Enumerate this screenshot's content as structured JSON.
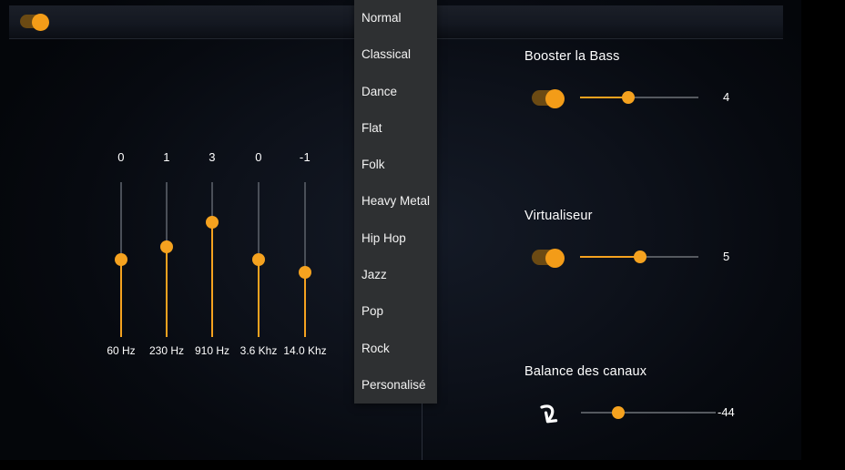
{
  "window": {
    "toolbar": {
      "power_toggle_label": "power-toggle",
      "power_toggle_state": "on"
    }
  },
  "equalizer": {
    "bands": [
      {
        "value": "0",
        "freq": "60 Hz",
        "level": 0,
        "knob_pct": 50
      },
      {
        "value": "1",
        "freq": "230 Hz",
        "level": 1,
        "knob_pct": 42
      },
      {
        "value": "3",
        "freq": "910 Hz",
        "level": 3,
        "knob_pct": 26
      },
      {
        "value": "0",
        "freq": "3.6 Khz",
        "level": 0,
        "knob_pct": 50
      },
      {
        "value": "-1",
        "freq": "14.0 Khz",
        "level": -1,
        "knob_pct": 58
      }
    ]
  },
  "preset_menu": {
    "items": [
      "Normal",
      "Classical",
      "Dance",
      "Flat",
      "Folk",
      "Heavy Metal",
      "Hip Hop",
      "Jazz",
      "Pop",
      "Rock",
      "Personalisé"
    ],
    "selected": "Normal"
  },
  "controls": [
    {
      "title": "Booster la Bass",
      "toggle_state": "on",
      "value": "4",
      "fill_pct": 41,
      "has_toggle": true,
      "has_reset_icon": false
    },
    {
      "title": "Virtualiseur",
      "toggle_state": "on",
      "value": "5",
      "fill_pct": 51,
      "has_toggle": true,
      "has_reset_icon": false
    },
    {
      "title": "Balance des canaux",
      "toggle_state": "off",
      "value": "-44",
      "fill_pct": 0,
      "knob_pct": 28,
      "has_toggle": false,
      "has_reset_icon": true,
      "reset_icon": "undo-arrow-icon"
    }
  ],
  "colors": {
    "accent": "#f5a21f",
    "toggle_track": "#6b4a13",
    "rail": "#55595f",
    "menu_bg": "#2e3032",
    "text": "#ffffff"
  }
}
